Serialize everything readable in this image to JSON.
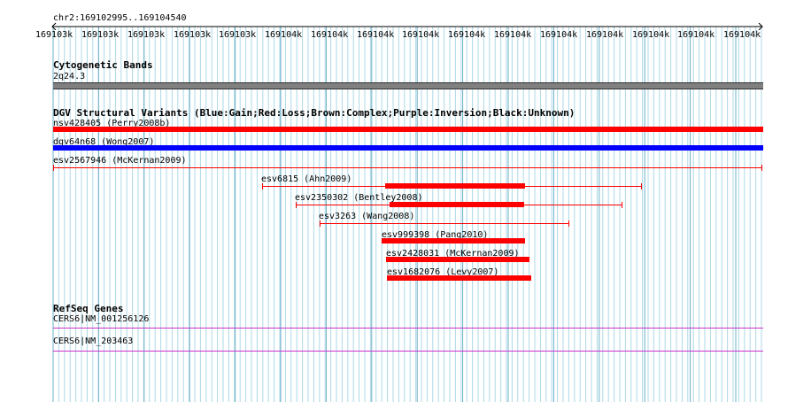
{
  "ruler": {
    "location": "chr2:169102995..169104540",
    "tick_labels": [
      "169103k",
      "169103k",
      "169103k",
      "169103k",
      "169103k",
      "169104k",
      "169104k",
      "169104k",
      "169104k",
      "169104k",
      "169104k",
      "169104k",
      "169104k",
      "169104k",
      "169104k",
      "169104k"
    ]
  },
  "cytoband": {
    "title": "Cytogenetic Bands",
    "band": "2q24.3"
  },
  "dgv": {
    "title": "DGV Structural Variants (Blue:Gain;Red:Loss;Brown:Complex;Purple:Inversion;Black:Unknown)",
    "colors": {
      "gain": "#0000ff",
      "loss": "#ff0000"
    },
    "variants": [
      {
        "label": "nsv428405 (Perry2008b)"
      },
      {
        "label": "dgv64n68 (Wong2007)"
      },
      {
        "label": "esv2567946 (McKernan2009)"
      },
      {
        "label": "esv6815 (Ahn2009)"
      },
      {
        "label": "esv2350302 (Bentley2008)"
      },
      {
        "label": "esv3263 (Wang2008)"
      },
      {
        "label": "esv999398 (Pang2010)"
      },
      {
        "label": "esv2428031 (McKernan2009)"
      },
      {
        "label": "esv1682076 (Levy2007)"
      }
    ]
  },
  "refseq": {
    "title": "RefSeq Genes",
    "color": "#cc33cc",
    "genes": [
      {
        "label": "CERS6|NM_001256126"
      },
      {
        "label": "CERS6|NM_203463"
      }
    ]
  }
}
